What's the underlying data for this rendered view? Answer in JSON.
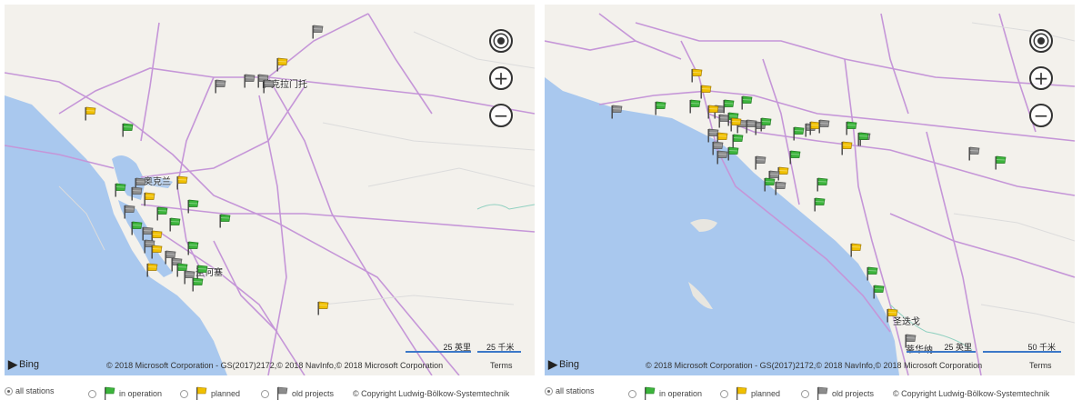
{
  "colors": {
    "land": "#f3f1ec",
    "water": "#a9c8ee",
    "highway": "#c596d8",
    "road": "#dcdcdc",
    "flag_green": "#3cb43c",
    "flag_yellow": "#f0c000",
    "flag_gray": "#8c8c8c",
    "scale_bar": "#3c78c8"
  },
  "legend": {
    "all_stations": "all stations",
    "in_operation": "in operation",
    "planned": "planned",
    "old_projects": "old projects",
    "copyright": "© Copyright Ludwig-Bölkow-Systemtechnik",
    "selected": "all stations"
  },
  "icons": {
    "locate": "locate-icon",
    "zoom_in": "zoom-in-icon",
    "zoom_out": "zoom-out-icon",
    "bing_logo": "bing-logo"
  },
  "maps": [
    {
      "region": "San Francisco Bay Area",
      "city_labels": [
        "萨克拉门托",
        "奥克兰",
        "圣何塞"
      ],
      "scale_imperial": "25 英里",
      "scale_metric": "25 千米",
      "bing_label": "Bing",
      "copyright": "© 2018 Microsoft Corporation - GS(2017)2172,© 2018 NavInfo,© 2018 Microsoft Corporation",
      "terms": "Terms",
      "stations": [
        {
          "status": "gray"
        },
        {
          "status": "yellow"
        },
        {
          "status": "gray"
        },
        {
          "status": "gray"
        },
        {
          "status": "gray"
        },
        {
          "status": "yellow"
        },
        {
          "status": "green"
        },
        {
          "status": "gray"
        },
        {
          "status": "gray"
        },
        {
          "status": "yellow"
        },
        {
          "status": "green"
        },
        {
          "status": "gray"
        },
        {
          "status": "yellow"
        },
        {
          "status": "gray"
        },
        {
          "status": "green"
        },
        {
          "status": "green"
        },
        {
          "status": "green"
        },
        {
          "status": "green"
        },
        {
          "status": "gray"
        },
        {
          "status": "yellow"
        },
        {
          "status": "green"
        },
        {
          "status": "gray"
        },
        {
          "status": "yellow"
        },
        {
          "status": "gray"
        },
        {
          "status": "green"
        },
        {
          "status": "gray"
        },
        {
          "status": "green"
        },
        {
          "status": "yellow"
        },
        {
          "status": "gray"
        },
        {
          "status": "green"
        },
        {
          "status": "green"
        },
        {
          "status": "yellow"
        }
      ]
    },
    {
      "region": "Los Angeles / San Diego",
      "city_labels": [
        "圣迭戈",
        "蒂华纳"
      ],
      "scale_imperial": "25 英里",
      "scale_metric": "50 千米",
      "bing_label": "Bing",
      "copyright": "© 2018 Microsoft Corporation - GS(2017)2172,© 2018 NavInfo,© 2018 Microsoft Corporation",
      "terms": "Terms",
      "stations": [
        {
          "status": "yellow"
        },
        {
          "status": "yellow"
        },
        {
          "status": "gray"
        },
        {
          "status": "green"
        },
        {
          "status": "green"
        },
        {
          "status": "gray"
        },
        {
          "status": "yellow"
        },
        {
          "status": "green"
        },
        {
          "status": "green"
        },
        {
          "status": "gray"
        },
        {
          "status": "green"
        },
        {
          "status": "gray"
        },
        {
          "status": "gray"
        },
        {
          "status": "yellow"
        },
        {
          "status": "gray"
        },
        {
          "status": "green"
        },
        {
          "status": "gray"
        },
        {
          "status": "yellow"
        },
        {
          "status": "gray"
        },
        {
          "status": "green"
        },
        {
          "status": "green"
        },
        {
          "status": "gray"
        },
        {
          "status": "yellow"
        },
        {
          "status": "gray"
        },
        {
          "status": "green"
        },
        {
          "status": "gray"
        },
        {
          "status": "yellow"
        },
        {
          "status": "gray"
        },
        {
          "status": "green"
        },
        {
          "status": "gray"
        },
        {
          "status": "green"
        },
        {
          "status": "yellow"
        },
        {
          "status": "gray"
        },
        {
          "status": "green"
        },
        {
          "status": "gray"
        },
        {
          "status": "green"
        },
        {
          "status": "green"
        },
        {
          "status": "gray"
        },
        {
          "status": "green"
        },
        {
          "status": "green"
        },
        {
          "status": "yellow"
        },
        {
          "status": "green"
        },
        {
          "status": "yellow"
        },
        {
          "status": "gray"
        },
        {
          "status": "green"
        }
      ]
    }
  ]
}
